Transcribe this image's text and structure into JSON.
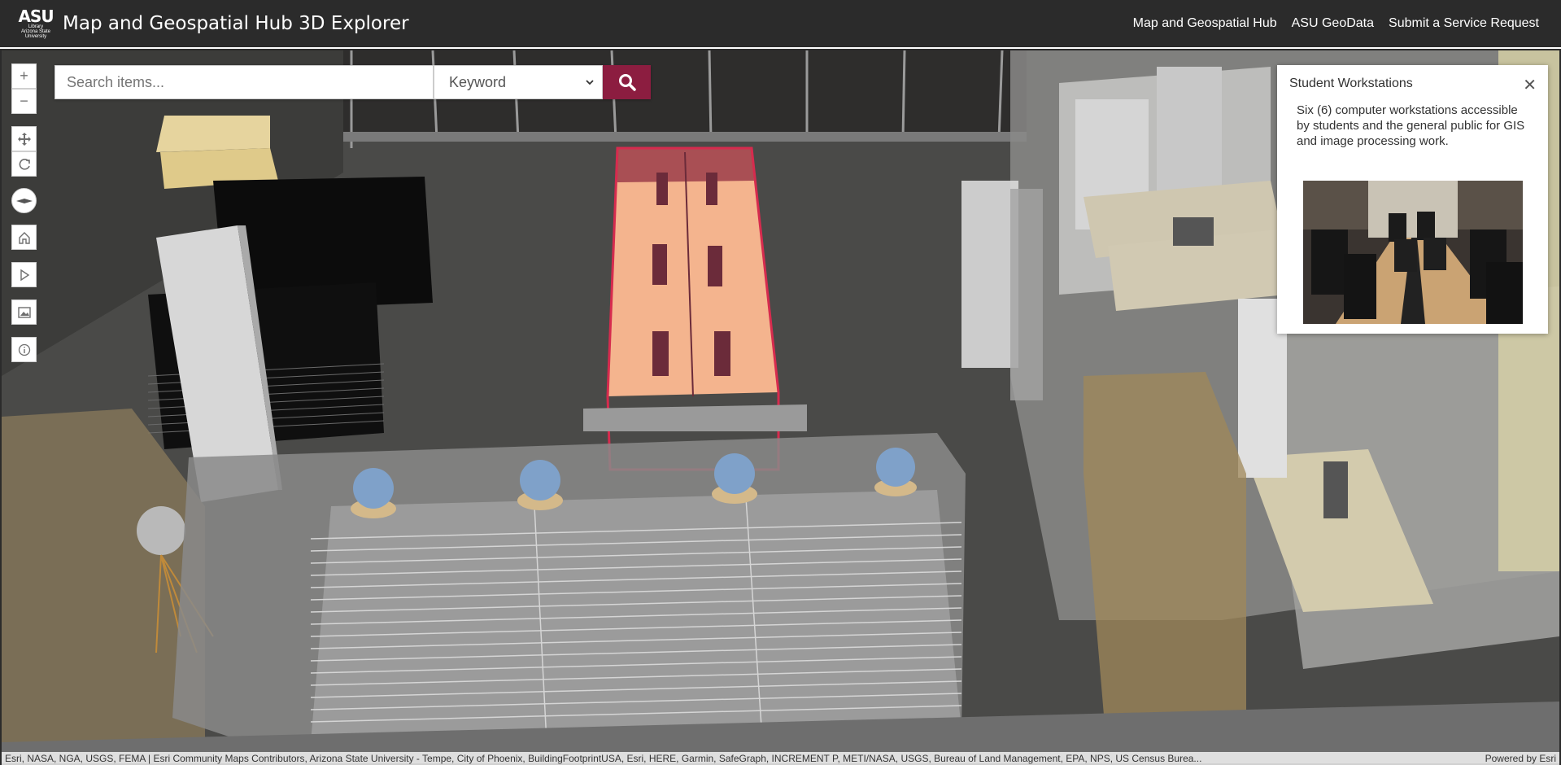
{
  "header": {
    "logo_big": "ASU",
    "logo_small_1": "Library",
    "logo_small_2": "Arizona State",
    "logo_small_3": "University",
    "title": "Map and Geospatial Hub 3D Explorer",
    "links": [
      "Map and Geospatial Hub",
      "ASU GeoData",
      "Submit a Service Request"
    ]
  },
  "toolbar": {
    "zoom_in": "+",
    "zoom_out": "−",
    "pan_icon": "pan-icon",
    "rotate_icon": "rotate-icon",
    "compass_icon": "compass-icon",
    "home_icon": "home-icon",
    "play_icon": "play-icon",
    "basemap_icon": "image-icon",
    "info_icon": "info-icon"
  },
  "search": {
    "placeholder": "Search items...",
    "mode": "Keyword",
    "button_icon": "search-icon"
  },
  "popup": {
    "title": "Student Workstations",
    "description": "Six (6) computer workstations accessible by students and the general public for GIS and image processing work."
  },
  "attribution": {
    "credits": "Esri, NASA, NGA, USGS, FEMA | Esri Community Maps Contributors, Arizona State University - Tempe, City of Phoenix, BuildingFootprintUSA, Esri, HERE, Garmin, SafeGraph, INCREMENT P, METI/NASA, USGS, Bureau of Land Management, EPA, NPS, US Census Burea...",
    "powered": "Powered by Esri"
  },
  "colors": {
    "header_bg": "#2b2b2b",
    "accent": "#8c1d40",
    "highlight": "#d62b4e"
  }
}
